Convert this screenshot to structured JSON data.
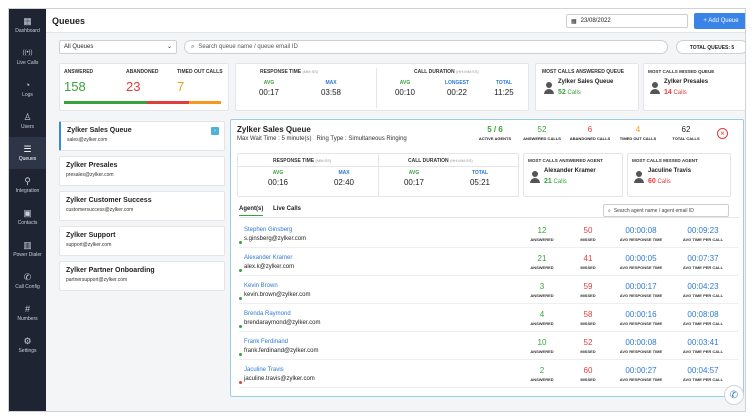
{
  "sidebar": {
    "items": [
      {
        "label": "Dashboard",
        "icon": "dashboard-icon",
        "glyph": "▦"
      },
      {
        "label": "Live Calls",
        "icon": "live-calls-icon",
        "glyph": "((•))"
      },
      {
        "label": "Logs",
        "icon": "logs-icon",
        "glyph": "◔"
      },
      {
        "label": "Users",
        "icon": "users-icon",
        "glyph": "♙"
      },
      {
        "label": "Queues",
        "icon": "queues-icon",
        "glyph": "☰"
      },
      {
        "label": "Integration",
        "icon": "integration-icon",
        "glyph": "⚲"
      },
      {
        "label": "Contacts",
        "icon": "contacts-icon",
        "glyph": "▣"
      },
      {
        "label": "Power Dialer",
        "icon": "power-dialer-icon",
        "glyph": "▥"
      },
      {
        "label": "Call Config",
        "icon": "call-config-icon",
        "glyph": "✆"
      },
      {
        "label": "Numbers",
        "icon": "numbers-icon",
        "glyph": "#"
      },
      {
        "label": "Settings",
        "icon": "settings-icon",
        "glyph": "⚙"
      }
    ]
  },
  "header": {
    "title": "Queues",
    "date": "23/08/2022",
    "add_label": "+ Add Queue"
  },
  "filters": {
    "select_value": "All Queues",
    "search_placeholder": "Search queue name / queue email ID",
    "total_label": "TOTAL QUEUES: 5"
  },
  "summary": {
    "answered_label": "ANSWERED",
    "answered_value": "158",
    "abandoned_label": "ABANDONED",
    "abandoned_value": "23",
    "timed_out_label": "TIMED OUT CALLS",
    "timed_out_value": "7",
    "response_time_label": "RESPONSE TIME",
    "response_time_unit": "(mm:ss)",
    "avg_label": "AVG",
    "max_label": "MAX",
    "rt_avg": "00:17",
    "rt_max": "03:58",
    "call_duration_label": "CALL DURATION",
    "call_duration_unit": "(hh:mm:ss)",
    "longest_label": "LONGEST",
    "total_label": "TOTAL",
    "cd_avg": "00:10",
    "cd_longest": "00:22",
    "cd_total": "11:25",
    "most_answered_label": "MOST CALLS ANSWERED QUEUE",
    "most_answered_name": "Zylker Sales Queue",
    "most_answered_count": "52",
    "most_missed_label": "MOST CALLS MISSED QUEUE",
    "most_missed_name": "Zylker Presales",
    "most_missed_count": "14",
    "calls_word": "Calls"
  },
  "queues": [
    {
      "name": "Zylker Sales Queue",
      "email": "sales@zylker.com"
    },
    {
      "name": "Zylker Presales",
      "email": "presales@zylker.com"
    },
    {
      "name": "Zylker Customer Success",
      "email": "customersuccess@zylker.com"
    },
    {
      "name": "Zylker Support",
      "email": "support@zylker.com"
    },
    {
      "name": "Zylker Partner Onboarding",
      "email": "partnersupport@zylker.com"
    }
  ],
  "detail": {
    "title": "Zylker Sales Queue",
    "max_wait": "Max Wait Time : 5 minute(s)",
    "ring_type": "Ring Type : Simultaneous Ringing",
    "active_agents_value": "5 / 6",
    "active_agents_label": "ACTIVE AGENTS",
    "answered_value": "52",
    "answered_label": "ANSWERED CALLS",
    "abandoned_value": "6",
    "abandoned_label": "ABANDONED CALLS",
    "timed_out_value": "4",
    "timed_out_label": "TIMED OUT CALLS",
    "total_value": "62",
    "total_label": "TOTAL CALLS",
    "rt_avg": "00:16",
    "rt_max": "02:40",
    "cd_avg": "00:17",
    "cd_total": "05:21",
    "most_answered_agent_label": "MOST CALLS ANSWERED AGENT",
    "most_answered_agent": "Alexander Kramer",
    "most_answered_agent_count": "21",
    "most_missed_agent_label": "MOST CALLS MISSED AGENT",
    "most_missed_agent": "Jaculine Travis",
    "most_missed_agent_count": "60",
    "tab_agents": "Agent(s)",
    "tab_live": "Live Calls",
    "agent_search_placeholder": "Search agent name / agent email ID",
    "col_answered": "ANSWERED",
    "col_missed": "MISSED",
    "col_avg_response": "AVG RESPONSE TIME",
    "col_avg_talk": "AVG TIME PER CALL"
  },
  "agents": [
    {
      "name": "Stephen Ginsberg",
      "email": "s.ginsberg@zylker.com",
      "answered": "12",
      "missed": "50",
      "avg_response": "00:00:08",
      "avg_time": "00:09:23",
      "status_color": "#3aa23c"
    },
    {
      "name": "Alexander Kramer",
      "email": "alex.k@zylker.com",
      "answered": "21",
      "missed": "41",
      "avg_response": "00:00:05",
      "avg_time": "00:07:37",
      "status_color": "#3aa23c"
    },
    {
      "name": "Kevin Brown",
      "email": "kevin.brown@zylker.com",
      "answered": "3",
      "missed": "59",
      "avg_response": "00:00:17",
      "avg_time": "00:04:23",
      "status_color": "#3aa23c"
    },
    {
      "name": "Brenda Raymond",
      "email": "brendaraymond@zylker.com",
      "answered": "4",
      "missed": "58",
      "avg_response": "00:00:16",
      "avg_time": "00:08:08",
      "status_color": "#3aa23c"
    },
    {
      "name": "Frank Ferdinand",
      "email": "frank.ferdinand@zylker.com",
      "answered": "10",
      "missed": "52",
      "avg_response": "00:00:08",
      "avg_time": "00:03:41",
      "status_color": "#3aa23c"
    },
    {
      "name": "Jaculine Travis",
      "email": "jaculine.travis@zylker.com",
      "answered": "2",
      "missed": "60",
      "avg_response": "00:00:27",
      "avg_time": "00:04:57",
      "status_color": "#e23c3c"
    }
  ],
  "colors": {
    "accent": "#3a84e8",
    "sidebar_bg": "#1e2431",
    "answered": "#3aa23c",
    "abandoned": "#e23c3c",
    "timed_out": "#f39a1e"
  }
}
